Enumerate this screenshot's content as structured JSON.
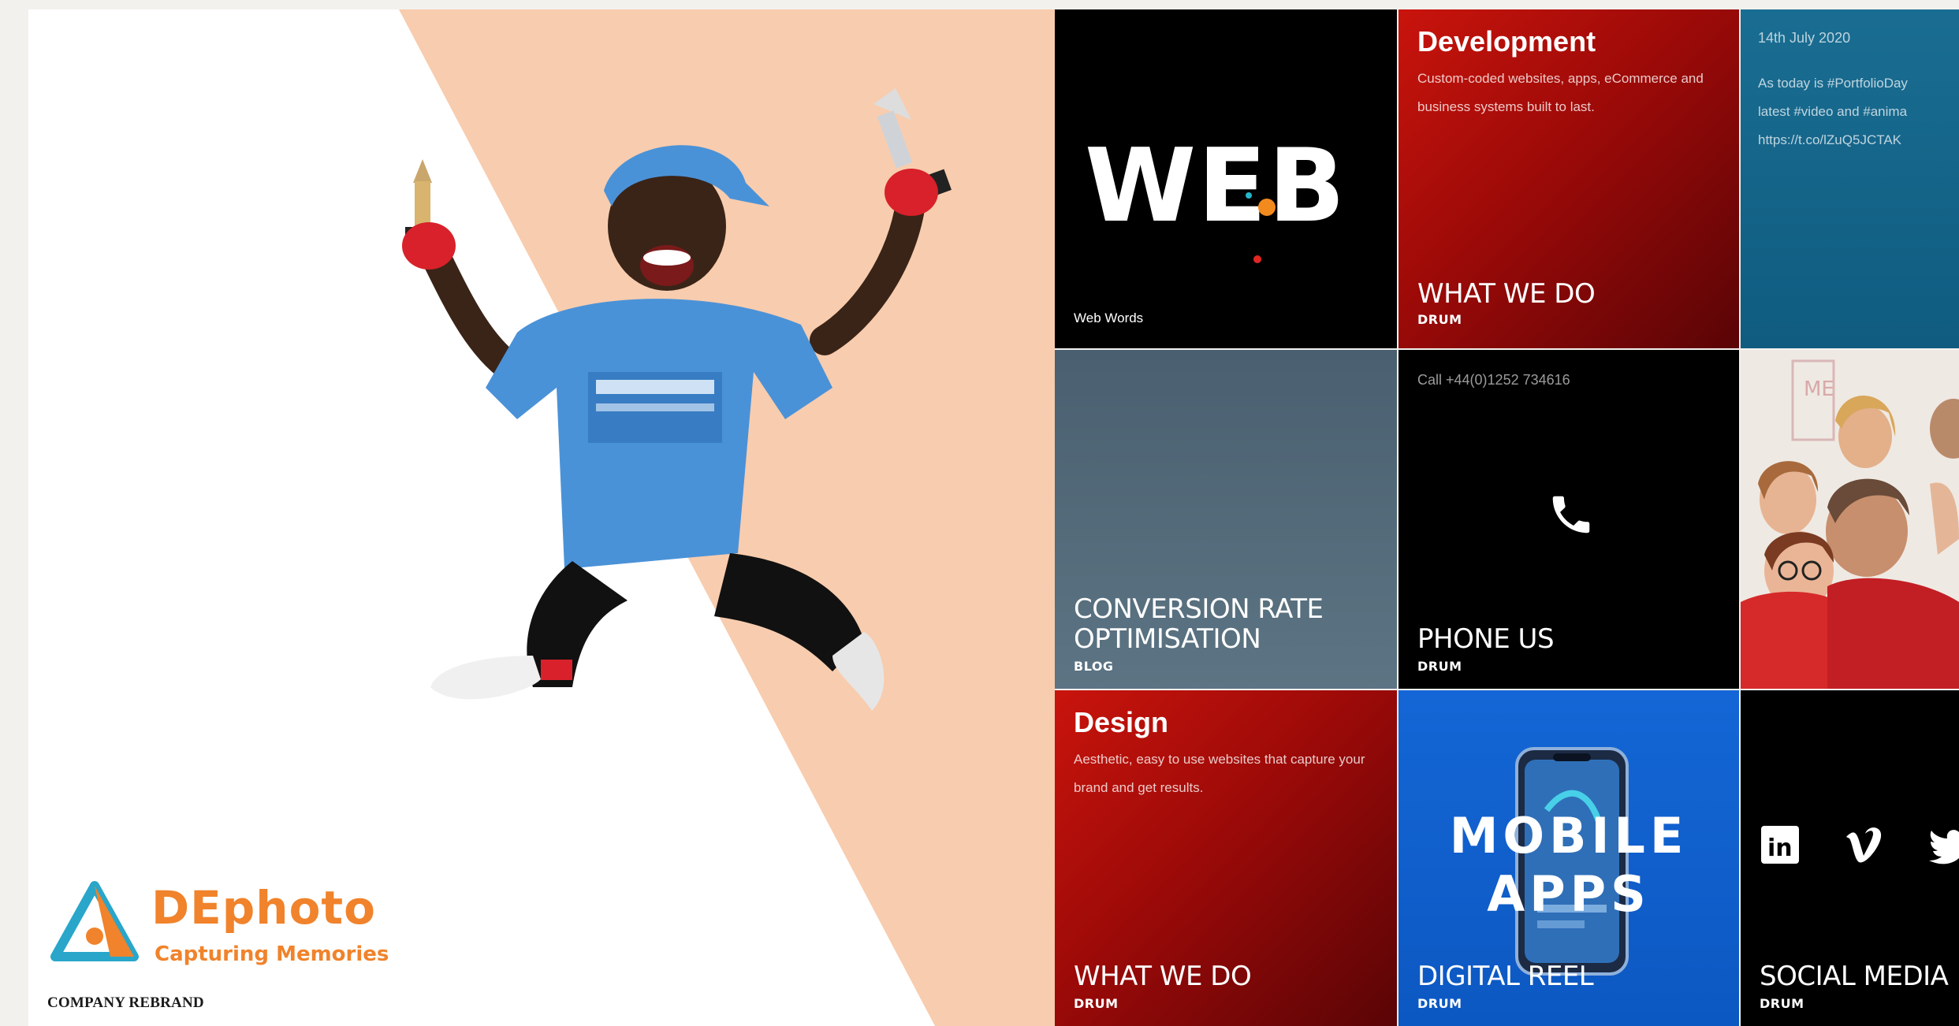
{
  "hero": {
    "brand_name": "DEphoto",
    "brand_tagline": "Capturing Memories",
    "caption": "COMPANY REBRAND",
    "colors": {
      "accent": "#f0832b",
      "wedge": "#f8ccae",
      "logo_blue": "#29a6c9"
    },
    "photo_icon": "jumping-boy-with-trophies-photo"
  },
  "tiles": {
    "web": {
      "word": "WEB",
      "caption": "Web Words"
    },
    "development": {
      "title": "Development",
      "desc": "Custom-coded websites, apps, eCommerce and business systems built to last.",
      "label": "WHAT WE DO",
      "sub": "DRUM"
    },
    "twitter": {
      "date": "14th July 2020",
      "text": "As today is #PortfolioDay\nlatest #video and #anima\nhttps://t.co/lZuQ5JCTAK"
    },
    "cro": {
      "label_line1": "CONVERSION RATE",
      "label_line2": "OPTIMISATION",
      "sub": "BLOG"
    },
    "phone": {
      "call": "Call +44(0)1252 734616",
      "label": "PHONE US",
      "sub": "DRUM",
      "icon": "phone-icon"
    },
    "team": {
      "icon": "team-photo",
      "sign": "ME"
    },
    "design": {
      "title": "Design",
      "desc": "Aesthetic, easy to use websites that capture your brand and get results.",
      "label": "WHAT WE DO",
      "sub": "DRUM"
    },
    "mobile": {
      "line1": "MOBILE",
      "line2": "APPS",
      "label": "DIGITAL REEL",
      "sub": "DRUM"
    },
    "social": {
      "label": "SOCIAL MEDIA",
      "sub": "DRUM",
      "icons": [
        "linkedin-icon",
        "vimeo-icon",
        "twitter-icon"
      ],
      "linkedin_glyph": "in"
    }
  }
}
